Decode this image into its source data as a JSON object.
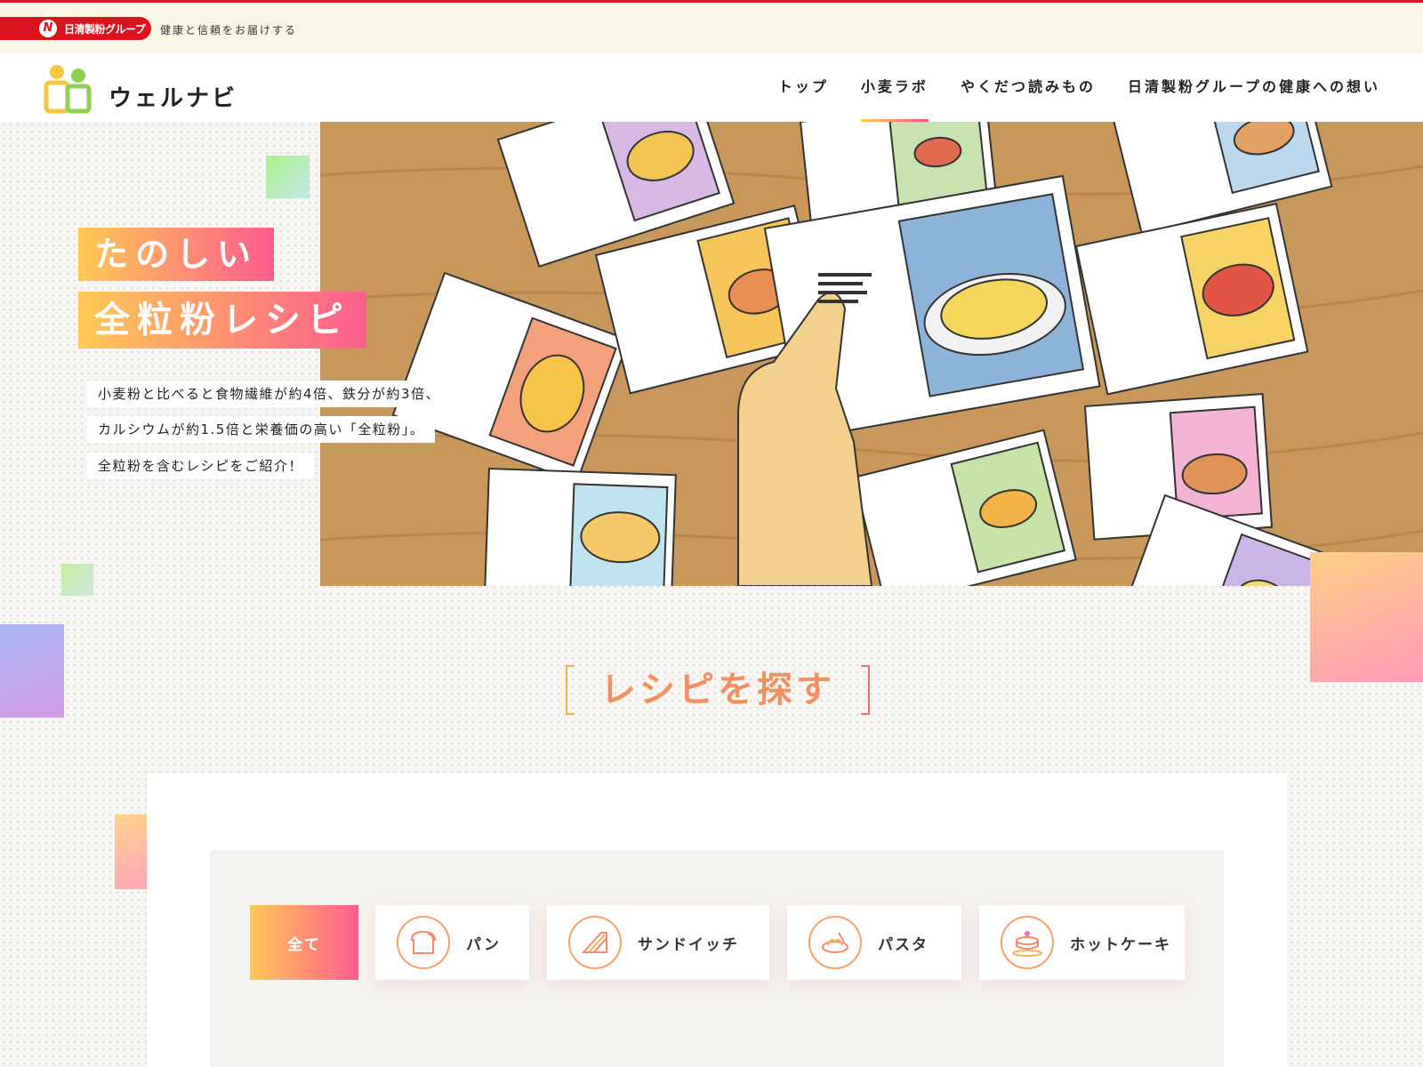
{
  "brand": {
    "group_name": "日清製粉グループ",
    "group_mark": "N",
    "tagline": "健康と信頼をお届けする",
    "site_name": "ウェルナビ",
    "primary_red": "#d9141e"
  },
  "nav": {
    "items": [
      {
        "label": "トップ",
        "active": false
      },
      {
        "label": "小麦ラボ",
        "active": true
      },
      {
        "label": "やくだつ読みもの",
        "active": false
      },
      {
        "label": "日清製粉グループの健康への想い",
        "active": false
      }
    ]
  },
  "hero": {
    "title_line1": "たのしい",
    "title_line2": "全粒粉レシピ",
    "desc_line1": "小麦粉と比べると食物繊維が約4倍、鉄分が約3倍、",
    "desc_line2": "カルシウムが約1.5倍と栄養価の高い「全粒粉」。",
    "desc_line3": "全粒粉を含むレシピをご紹介！",
    "gradient_start": "#ffc955",
    "gradient_end": "#ff5c8d"
  },
  "search": {
    "title": "レシピを探す",
    "filters": [
      {
        "label": "全て",
        "icon": "",
        "selected": true
      },
      {
        "label": "パン",
        "icon": "bread-icon",
        "selected": false
      },
      {
        "label": "サンドイッチ",
        "icon": "sandwich-icon",
        "selected": false
      },
      {
        "label": "パスタ",
        "icon": "pasta-icon",
        "selected": false
      },
      {
        "label": "ホットケーキ",
        "icon": "pancake-icon",
        "selected": false
      }
    ]
  }
}
